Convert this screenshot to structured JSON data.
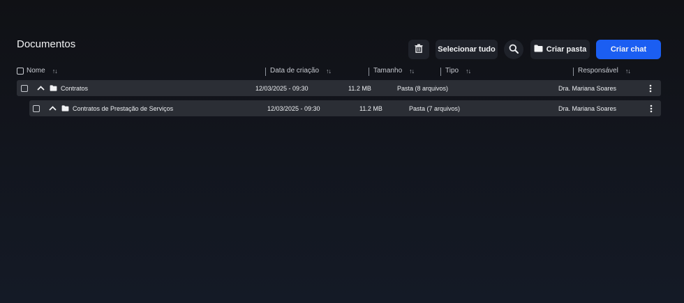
{
  "header": {
    "title": "Documentos"
  },
  "toolbar": {
    "delete_icon": "trash-icon",
    "select_all_label": "Selecionar tudo",
    "search_icon": "search-icon",
    "new_folder_label": "Criar pasta",
    "new_folder_icon": "folder-icon",
    "new_chat_label": "Criar chat",
    "accent_color": "#1b5ef2"
  },
  "table": {
    "columns": [
      {
        "label": "Nome",
        "sortable": true
      },
      {
        "label": "Data de criação",
        "sortable": true
      },
      {
        "label": "Tamanho",
        "sortable": true
      },
      {
        "label": "Tipo",
        "sortable": true
      },
      {
        "label": "Responsável",
        "sortable": true
      }
    ],
    "rows": [
      {
        "name": "Contratos",
        "date": "12/03/2025 - 09:30",
        "size": "11.2 MB",
        "type": "Pasta (8 arquivos)",
        "owner": "Dra. Mariana Soares",
        "expanded": true
      },
      {
        "name": "Contratos de Prestação de Serviços",
        "date": "12/03/2025 - 09:30",
        "size": "11.2 MB",
        "type": "Pasta (7 arquivos)",
        "owner": "Dra. Mariana Soares",
        "expanded": true
      }
    ]
  }
}
